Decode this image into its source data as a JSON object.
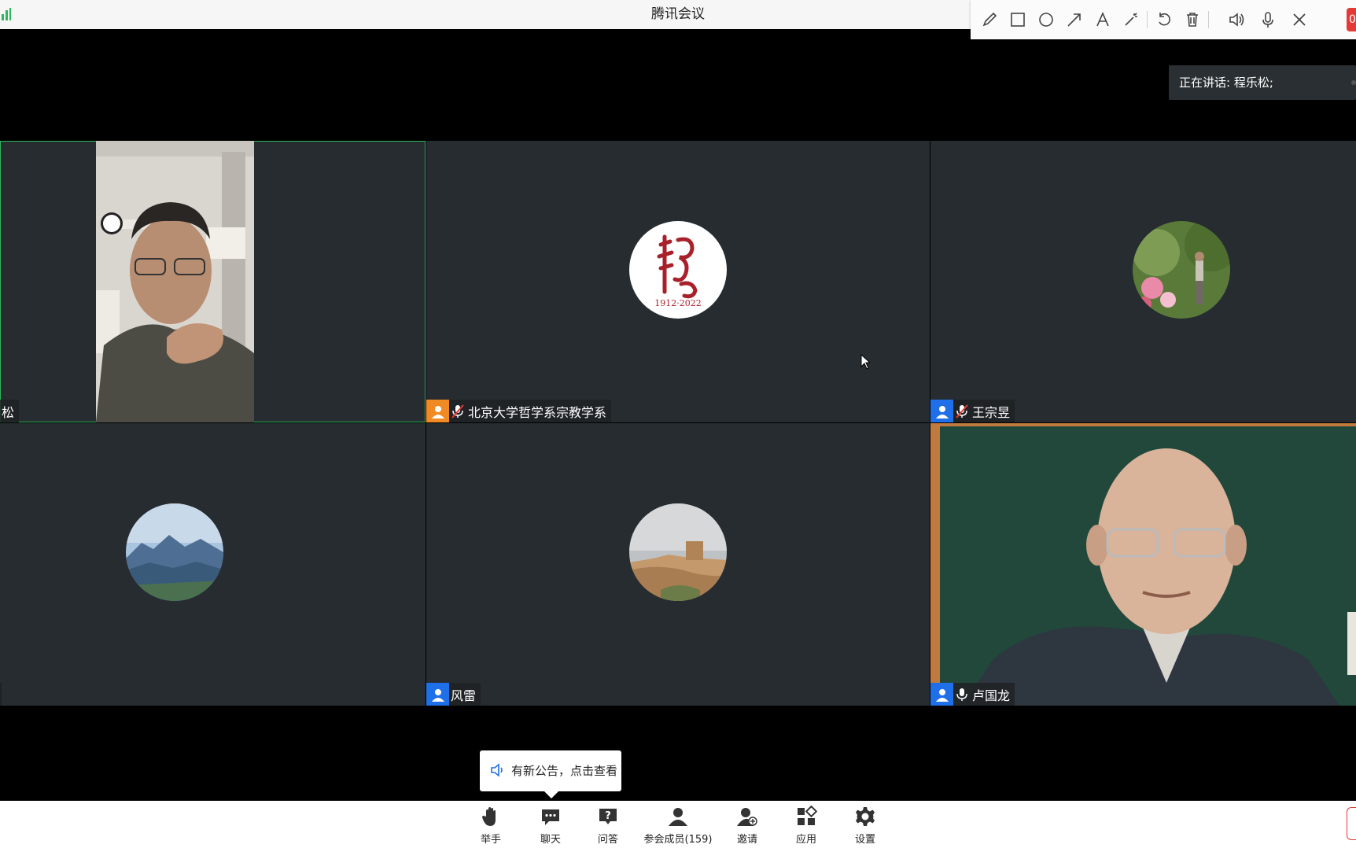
{
  "window": {
    "title": "腾讯会议"
  },
  "annotation_toolbar": {
    "tools": [
      "pencil-icon",
      "rectangle-icon",
      "circle-icon",
      "arrow-icon",
      "text-icon",
      "magic-wand-icon",
      "undo-icon",
      "trash-icon",
      "speaker-icon",
      "microphone-icon",
      "close-icon"
    ],
    "record_badge": "0"
  },
  "speaking": {
    "text": "正在讲话: 程乐松;"
  },
  "participants": [
    {
      "name": "松",
      "type": "video",
      "mic": "none"
    },
    {
      "name": "北京大学哲学系宗教学系",
      "type": "avatar",
      "mic": "muted",
      "badge": "orange",
      "avatar_text": "1912·2022"
    },
    {
      "name": "王宗昱",
      "type": "avatar",
      "mic": "muted",
      "badge": "blue"
    },
    {
      "name": "",
      "type": "avatar",
      "mic": "none"
    },
    {
      "name": "风雷",
      "type": "avatar",
      "mic": "none",
      "badge": "blue"
    },
    {
      "name": "卢国龙",
      "type": "video",
      "mic": "on",
      "badge": "blue"
    }
  ],
  "notice": {
    "text": "有新公告，点击查看"
  },
  "toolbar": {
    "raise_hand": "举手",
    "chat": "聊天",
    "qa": "问答",
    "members": "参会成员(159)",
    "invite": "邀请",
    "apps": "应用",
    "settings": "设置"
  },
  "colors": {
    "active_border": "#2eb75b",
    "badge_blue": "#1e6fe8",
    "badge_orange": "#f08a24",
    "tile_bg": "#262c30"
  }
}
